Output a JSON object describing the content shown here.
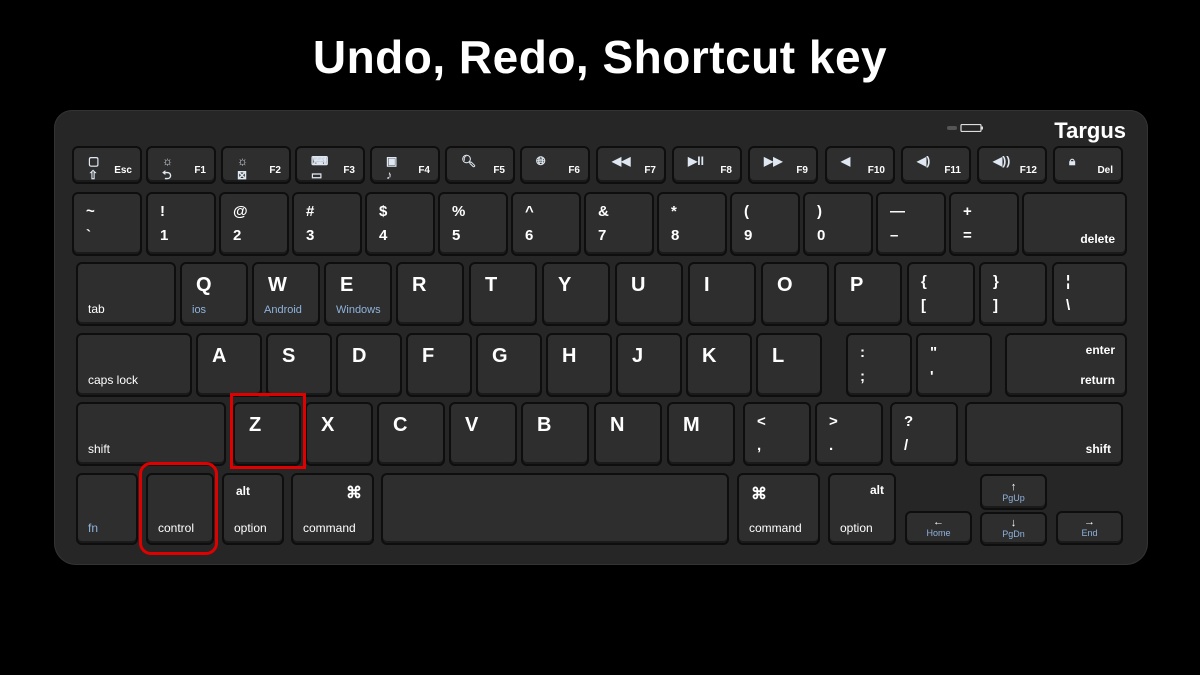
{
  "title": "Undo, Redo, Shortcut key",
  "brand": "Targus",
  "highlight_color": "#e00000",
  "highlighted_keys": [
    "control",
    "Z"
  ],
  "fn_row": [
    {
      "icon": "▢ ⇧",
      "label": "Esc",
      "icon_name": "home-icon"
    },
    {
      "icon": "☼ ⮌",
      "label": "F1",
      "icon_name": "brightness-down-icon"
    },
    {
      "icon": "☼ ⊠",
      "label": "F2",
      "icon_name": "brightness-up-icon"
    },
    {
      "icon": "⌨ ▭",
      "label": "F3",
      "icon_name": "keyboard-icon"
    },
    {
      "icon": "▣ ♪",
      "label": "F4",
      "icon_name": "media-icon"
    },
    {
      "icon": "🔍︎",
      "label": "F5",
      "icon_name": "search-icon"
    },
    {
      "icon": "🌐︎",
      "label": "F6",
      "icon_name": "globe-icon"
    },
    {
      "icon": "◀◀",
      "label": "F7",
      "icon_name": "rewind-icon"
    },
    {
      "icon": "▶II",
      "label": "F8",
      "icon_name": "play-pause-icon"
    },
    {
      "icon": "▶▶",
      "label": "F9",
      "icon_name": "fast-forward-icon"
    },
    {
      "icon": "◀",
      "label": "F10",
      "icon_name": "mute-icon"
    },
    {
      "icon": "◀)",
      "label": "F11",
      "icon_name": "volume-down-icon"
    },
    {
      "icon": "◀))",
      "label": "F12",
      "icon_name": "volume-up-icon"
    },
    {
      "icon": "🔒︎",
      "label": "Del",
      "icon_name": "lock-icon"
    }
  ],
  "number_row": [
    {
      "top": "~",
      "bottom": "`"
    },
    {
      "top": "!",
      "bottom": "1"
    },
    {
      "top": "@",
      "bottom": "2"
    },
    {
      "top": "#",
      "bottom": "3"
    },
    {
      "top": "$",
      "bottom": "4"
    },
    {
      "top": "%",
      "bottom": "5"
    },
    {
      "top": "^",
      "bottom": "6"
    },
    {
      "top": "&",
      "bottom": "7"
    },
    {
      "top": "*",
      "bottom": "8"
    },
    {
      "top": "(",
      "bottom": "9"
    },
    {
      "top": ")",
      "bottom": "0"
    },
    {
      "top": "—",
      "bottom": "–"
    },
    {
      "top": "+",
      "bottom": "="
    },
    {
      "label": "delete"
    }
  ],
  "qwerty_row": [
    {
      "label": "tab"
    },
    {
      "big": "Q",
      "sub": "ios"
    },
    {
      "big": "W",
      "sub": "Android"
    },
    {
      "big": "E",
      "sub": "Windows"
    },
    {
      "big": "R"
    },
    {
      "big": "T"
    },
    {
      "big": "Y"
    },
    {
      "big": "U"
    },
    {
      "big": "I"
    },
    {
      "big": "O"
    },
    {
      "big": "P"
    },
    {
      "top": "{",
      "bottom": "["
    },
    {
      "top": "}",
      "bottom": "]"
    },
    {
      "top": "¦",
      "bottom": "\\"
    }
  ],
  "home_row": [
    {
      "label": "caps lock"
    },
    {
      "big": "A"
    },
    {
      "big": "S"
    },
    {
      "big": "D"
    },
    {
      "big": "F"
    },
    {
      "big": "G"
    },
    {
      "big": "H"
    },
    {
      "big": "J"
    },
    {
      "big": "K"
    },
    {
      "big": "L"
    },
    {
      "top": ":",
      "bottom": ";"
    },
    {
      "top": "\"",
      "bottom": "'"
    },
    {
      "top_right": "enter",
      "bottom_right": "return"
    }
  ],
  "shift_row": [
    {
      "label": "shift"
    },
    {
      "big": "Z"
    },
    {
      "big": "X"
    },
    {
      "big": "C"
    },
    {
      "big": "V"
    },
    {
      "big": "B"
    },
    {
      "big": "N"
    },
    {
      "big": "M"
    },
    {
      "top": "<",
      "bottom": ","
    },
    {
      "top": ">",
      "bottom": "."
    },
    {
      "top": "?",
      "bottom": "/"
    },
    {
      "label_right": "shift"
    }
  ],
  "bottom_row": {
    "fn": "fn",
    "control": "control",
    "alt_left": {
      "top": "alt",
      "bottom": "option"
    },
    "cmd_left": {
      "top": "⌘",
      "bottom": "command"
    },
    "space": "",
    "cmd_right": {
      "top": "⌘",
      "bottom": "command"
    },
    "alt_right": {
      "top": "alt",
      "bottom": "option"
    },
    "home": {
      "arrow": "←",
      "label": "Home"
    },
    "pgup": {
      "arrow": "↑",
      "label": "PgUp"
    },
    "pgdn": {
      "arrow": "↓",
      "label": "PgDn"
    },
    "end": {
      "arrow": "→",
      "label": "End"
    }
  }
}
